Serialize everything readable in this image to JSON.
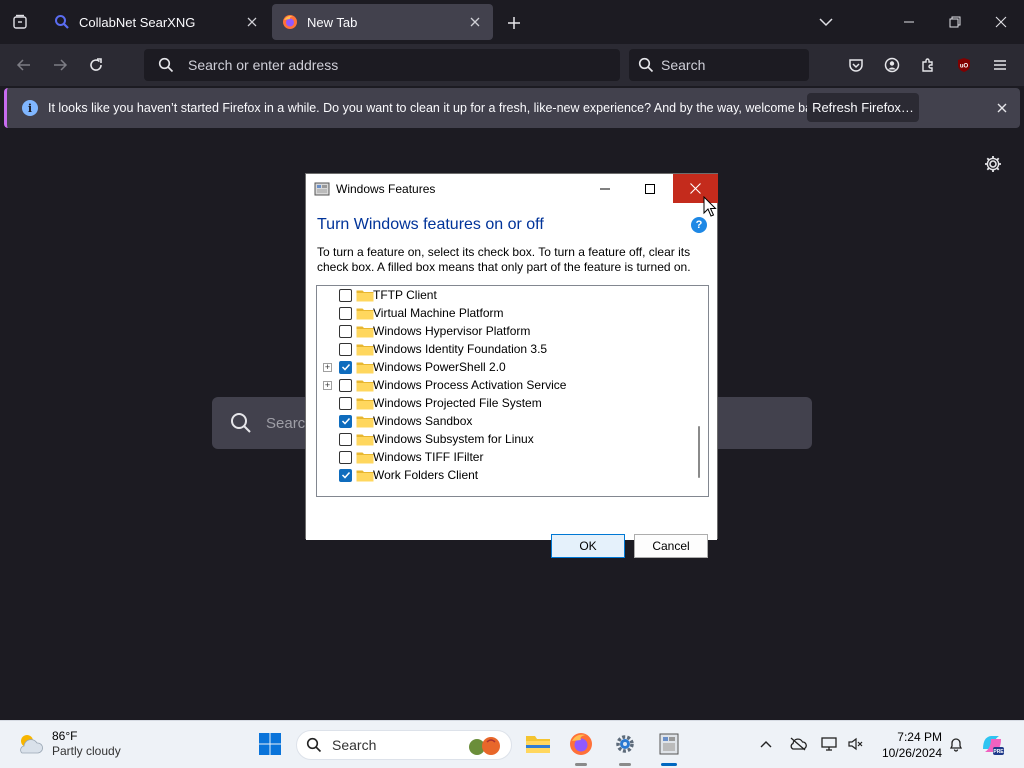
{
  "browser": {
    "tabs": [
      {
        "label": "CollabNet SearXNG",
        "active": false
      },
      {
        "label": "New Tab",
        "active": true
      }
    ],
    "urlbar": {
      "placeholder": "Search or enter address"
    },
    "searchbar": {
      "placeholder": "Search"
    },
    "notification": {
      "message": "It looks like you haven’t started Firefox in a while. Do you want to clean it up for a fresh, like-new experience? And by the way, welcome back!",
      "button": "Refresh Firefox…"
    },
    "newtab_search": {
      "placeholder": "Search"
    }
  },
  "dialog": {
    "title": "Windows Features",
    "heading": "Turn Windows features on or off",
    "description": "To turn a feature on, select its check box. To turn a feature off, clear its check box. A filled box means that only part of the feature is turned on.",
    "features": [
      {
        "label": "TFTP Client",
        "checked": false,
        "expandable": false
      },
      {
        "label": "Virtual Machine Platform",
        "checked": false,
        "expandable": false
      },
      {
        "label": "Windows Hypervisor Platform",
        "checked": false,
        "expandable": false
      },
      {
        "label": "Windows Identity Foundation 3.5",
        "checked": false,
        "expandable": false
      },
      {
        "label": "Windows PowerShell 2.0",
        "checked": true,
        "expandable": true
      },
      {
        "label": "Windows Process Activation Service",
        "checked": false,
        "expandable": true
      },
      {
        "label": "Windows Projected File System",
        "checked": false,
        "expandable": false
      },
      {
        "label": "Windows Sandbox",
        "checked": true,
        "expandable": false
      },
      {
        "label": "Windows Subsystem for Linux",
        "checked": false,
        "expandable": false
      },
      {
        "label": "Windows TIFF IFilter",
        "checked": false,
        "expandable": false
      },
      {
        "label": "Work Folders Client",
        "checked": true,
        "expandable": false
      }
    ],
    "ok": "OK",
    "cancel": "Cancel"
  },
  "taskbar": {
    "weather": {
      "temp": "86°F",
      "condition": "Partly cloudy"
    },
    "search": "Search",
    "time": "7:24 PM",
    "date": "10/26/2024"
  },
  "colors": {
    "accent": "#0f6cbd",
    "close_red": "#c42b1c",
    "heading_blue": "#003399",
    "notification_accent": "#c86cf0"
  }
}
